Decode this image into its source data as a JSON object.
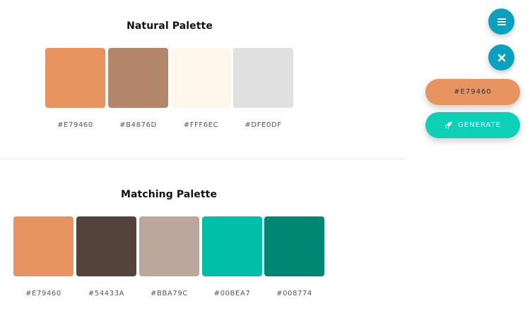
{
  "natural": {
    "title": "Natural Palette",
    "swatches": [
      {
        "hex": "#E79460",
        "color": "#E79460"
      },
      {
        "hex": "#B4876D",
        "color": "#B4876D"
      },
      {
        "hex": "#FFF6EC",
        "color": "#FFF6EC"
      },
      {
        "hex": "#DFE0DF",
        "color": "#DFE0DF"
      }
    ]
  },
  "matching": {
    "title": "Matching Palette",
    "swatches": [
      {
        "hex": "#E79460",
        "color": "#E79460"
      },
      {
        "hex": "#54433A",
        "color": "#54433A"
      },
      {
        "hex": "#BBA79C",
        "color": "#BBA79C"
      },
      {
        "hex": "#00BEA7",
        "color": "#00BEA7"
      },
      {
        "hex": "#008774",
        "color": "#008774"
      }
    ]
  },
  "sidebar": {
    "menu_icon": "hamburger-menu-icon",
    "close_icon": "close-x-icon",
    "current_color_label": "#E79460",
    "current_color": "#E79460",
    "generate_label": "GENERATE",
    "generate_icon": "rocket-icon",
    "generate_color": "#0DD0B6",
    "fab_color": "#0AA1C0"
  }
}
